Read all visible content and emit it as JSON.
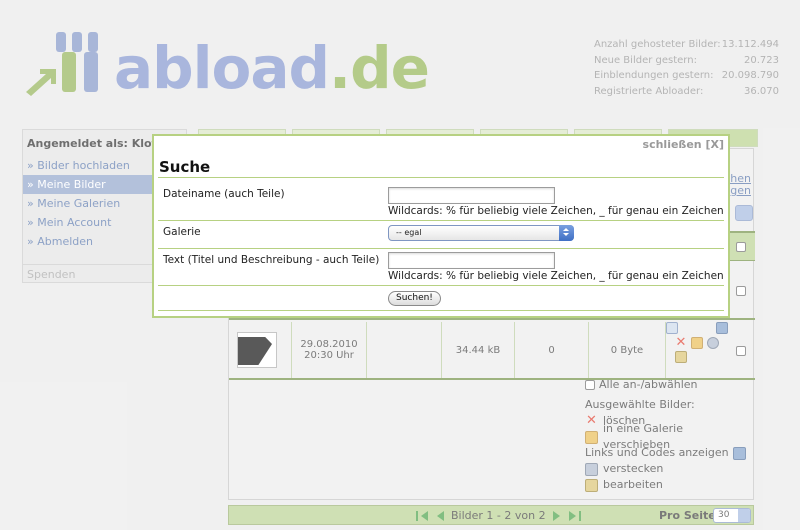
{
  "header": {
    "logo_text_main": "abload",
    "logo_text_dot": ".",
    "logo_text_tld": "de",
    "stats": [
      {
        "label": "Anzahl gehosteter Bilder:",
        "value": "13.112.494"
      },
      {
        "label": "Neue Bilder gestern:",
        "value": "20.723"
      },
      {
        "label": "Einblendungen gestern:",
        "value": "20.098.790"
      },
      {
        "label": "Registrierte Abloader:",
        "value": "36.070"
      }
    ]
  },
  "sidebar": {
    "logged_in": "Angemeldet als: Klotz",
    "items": [
      {
        "label": "» Bilder hochladen"
      },
      {
        "label": "» Meine Bilder"
      },
      {
        "label": "» Meine Galerien"
      },
      {
        "label": "» Mein Account"
      },
      {
        "label": "» Abmelden"
      }
    ],
    "spenden": "Spenden"
  },
  "main": {
    "tab_last_fragment": "t",
    "link_suchen": "chen",
    "link_anzeigen": "igen",
    "row2": {
      "date": "29.08.2010",
      "time": "20:30 Uhr",
      "size": "34.44 kB",
      "count": "0",
      "bytes": "0 Byte"
    },
    "select_all": "Alle an-/abwählen",
    "selected_title": "Ausgewählte Bilder:",
    "bulk_actions": [
      {
        "label": "löschen",
        "icon": "delete-icon"
      },
      {
        "label": "in eine Galerie verschieben",
        "icon": "folder-icon"
      },
      {
        "label": "Links und Codes anzeigen",
        "icon": "link-icon"
      },
      {
        "label": "verstecken",
        "icon": "hide-icon"
      },
      {
        "label": "bearbeiten",
        "icon": "edit-icon"
      }
    ],
    "pager": {
      "text": "Bilder 1 - 2 von 2",
      "per_page_label": "Pro Seite:",
      "per_page_value": "30"
    }
  },
  "dialog": {
    "close": "schließen [X]",
    "title": "Suche",
    "filename_label": "Dateiname (auch Teile)",
    "filename_value": "",
    "wildcard_hint": "Wildcards: % für beliebig viele Zeichen, _ für genau ein Zeichen",
    "gallery_label": "Galerie",
    "gallery_value": "-- egal",
    "text_label": "Text (Titel und Beschreibung - auch Teile)",
    "text_value": "",
    "wildcard_hint2": "Wildcards: % für beliebig viele Zeichen, _ für genau ein Zeichen",
    "submit": "Suchen!"
  },
  "colors": {
    "accent_green": "#b7d182",
    "nav_blue": "#4f6fa8",
    "active_blue": "#8ba0c8"
  }
}
